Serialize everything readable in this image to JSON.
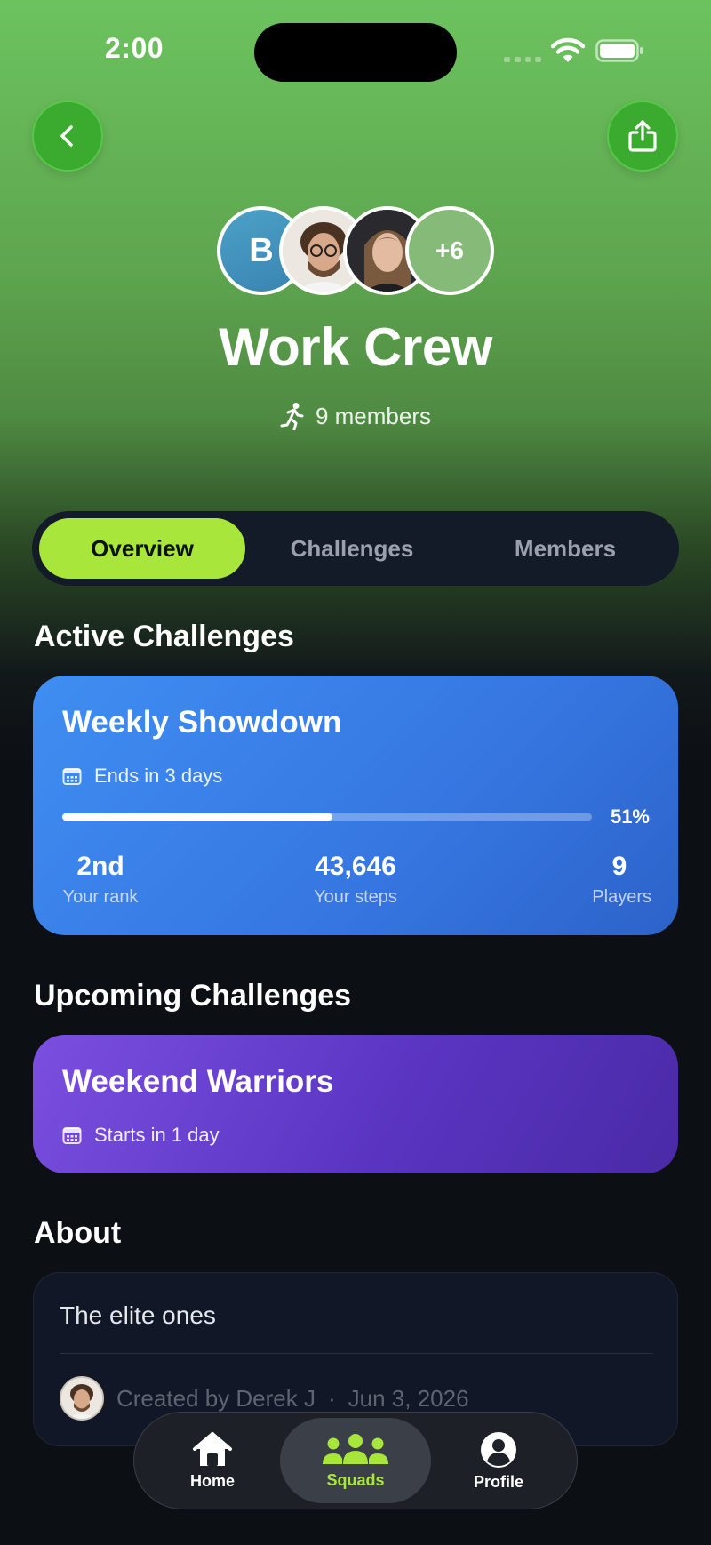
{
  "status_bar": {
    "time": "2:00"
  },
  "header": {
    "avatars": {
      "initial": "B",
      "more": "+6"
    },
    "title": "Work Crew",
    "members_text": "9 members"
  },
  "tabs": [
    {
      "label": "Overview",
      "active": true
    },
    {
      "label": "Challenges",
      "active": false
    },
    {
      "label": "Members",
      "active": false
    }
  ],
  "active_section": {
    "title": "Active Challenges",
    "card": {
      "title": "Weekly Showdown",
      "date_text": "Ends in 3 days",
      "progress": 0.51,
      "progress_label": "51%",
      "stats": [
        {
          "value": "2nd",
          "label": "Your rank"
        },
        {
          "value": "43,646",
          "label": "Your steps"
        },
        {
          "value": "9",
          "label": "Players"
        }
      ]
    }
  },
  "upcoming_section": {
    "title": "Upcoming Challenges",
    "card": {
      "title": "Weekend Warriors",
      "date_text": "Starts in 1 day"
    }
  },
  "about_section": {
    "title": "About",
    "description": "The elite ones",
    "created_by": "Created by Derek J",
    "separator": "·",
    "created_date": "Jun 3, 2026"
  },
  "tabbar": [
    {
      "label": "Home",
      "icon": "home-icon",
      "active": false
    },
    {
      "label": "Squads",
      "icon": "squads-icon",
      "active": true
    },
    {
      "label": "Profile",
      "icon": "profile-icon",
      "active": false
    }
  ],
  "colors": {
    "accent": "#a8e63c",
    "active_card": "#3f8ef2",
    "upcoming_card": "#6a42d4",
    "header_green": "#6cc35e",
    "background": "#0c0f14"
  }
}
